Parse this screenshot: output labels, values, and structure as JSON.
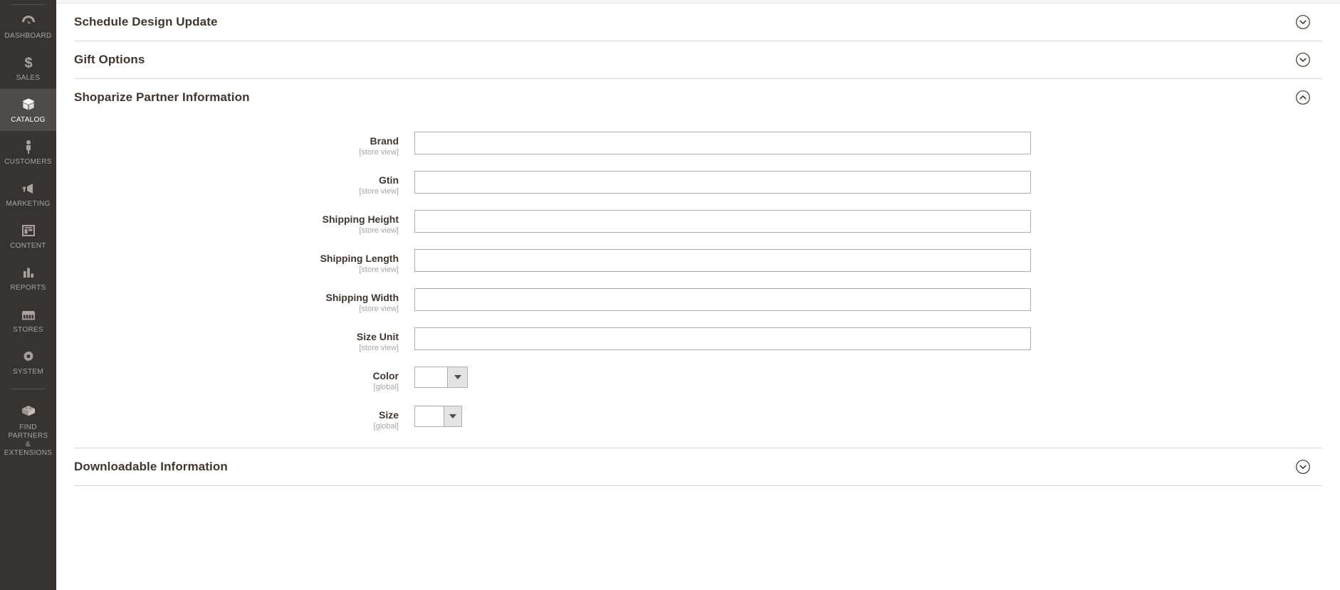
{
  "sidebar": {
    "items": [
      {
        "label": "DASHBOARD",
        "icon": "dashboard-icon",
        "active": false
      },
      {
        "label": "SALES",
        "icon": "dollar-icon",
        "active": false
      },
      {
        "label": "CATALOG",
        "icon": "box-icon",
        "active": true
      },
      {
        "label": "CUSTOMERS",
        "icon": "person-icon",
        "active": false
      },
      {
        "label": "MARKETING",
        "icon": "megaphone-icon",
        "active": false
      },
      {
        "label": "CONTENT",
        "icon": "layout-icon",
        "active": false
      },
      {
        "label": "REPORTS",
        "icon": "bar-chart-icon",
        "active": false
      },
      {
        "label": "STORES",
        "icon": "storefront-icon",
        "active": false
      },
      {
        "label": "SYSTEM",
        "icon": "gear-icon",
        "active": false
      },
      {
        "label": "FIND PARTNERS\n& EXTENSIONS",
        "icon": "extension-block-icon",
        "active": false
      }
    ],
    "colors": {
      "background": "#373330",
      "active_background": "#4f4b48",
      "label": "#a9a2a0",
      "active_label": "#ffffff"
    }
  },
  "sections": [
    {
      "id": "schedule-design-update",
      "title": "Schedule Design Update",
      "expanded": false,
      "toggle_icon": "chevron-down-icon"
    },
    {
      "id": "gift-options",
      "title": "Gift Options",
      "expanded": false,
      "toggle_icon": "chevron-down-icon"
    },
    {
      "id": "shoparize-partner-information",
      "title": "Shoparize Partner Information",
      "expanded": true,
      "toggle_icon": "chevron-up-icon"
    },
    {
      "id": "downloadable-information",
      "title": "Downloadable Information",
      "expanded": false,
      "toggle_icon": "chevron-down-icon"
    }
  ],
  "form": {
    "fields": [
      {
        "id": "brand",
        "label": "Brand",
        "scope": "[store view]",
        "type": "text",
        "value": "",
        "placeholder": ""
      },
      {
        "id": "gtin",
        "label": "Gtin",
        "scope": "[store view]",
        "type": "text",
        "value": "",
        "placeholder": ""
      },
      {
        "id": "shipping-height",
        "label": "Shipping Height",
        "scope": "[store view]",
        "type": "text",
        "value": "",
        "placeholder": ""
      },
      {
        "id": "shipping-length",
        "label": "Shipping Length",
        "scope": "[store view]",
        "type": "text",
        "value": "",
        "placeholder": ""
      },
      {
        "id": "shipping-width",
        "label": "Shipping Width",
        "scope": "[store view]",
        "type": "text",
        "value": "",
        "placeholder": ""
      },
      {
        "id": "size-unit",
        "label": "Size Unit",
        "scope": "[store view]",
        "type": "text",
        "value": "",
        "placeholder": ""
      },
      {
        "id": "color",
        "label": "Color",
        "scope": "[global]",
        "type": "select",
        "value": "",
        "placeholder": ""
      },
      {
        "id": "size",
        "label": "Size",
        "scope": "[global]",
        "type": "select",
        "value": "",
        "placeholder": ""
      }
    ]
  },
  "colors": {
    "accent": "#eb5202",
    "heading": "#41362f",
    "border": "#adadad",
    "divider": "#d6d6d6",
    "scope_text": "#a6a6a6",
    "select_button": "#e3e3e3"
  }
}
